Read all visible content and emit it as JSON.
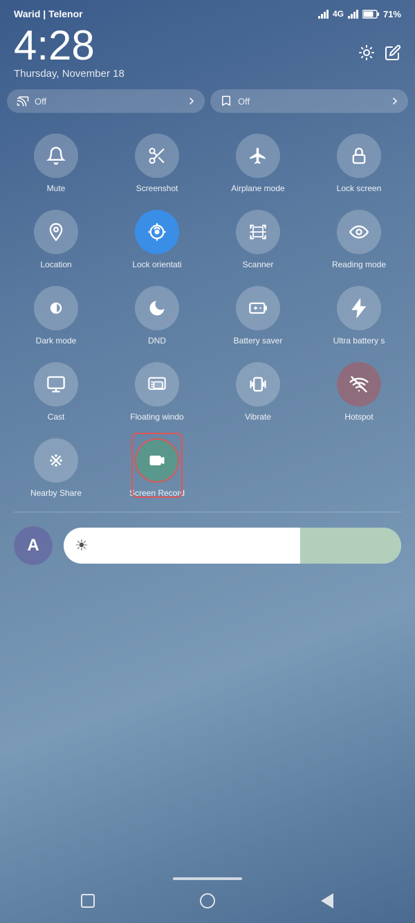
{
  "statusBar": {
    "carrier": "Warid | Telenor",
    "networkType": "4G",
    "batteryPercent": "71%"
  },
  "clock": {
    "time": "4:28",
    "date": "Thursday, November 18"
  },
  "quickToggles": [
    {
      "id": "cast-off",
      "icon": "cast",
      "label": "Off",
      "active": false
    },
    {
      "id": "bookmark-off",
      "icon": "bookmark",
      "label": "Off",
      "active": false
    }
  ],
  "quickGrid": [
    {
      "id": "mute",
      "label": "Mute",
      "icon": "bell",
      "active": false
    },
    {
      "id": "screenshot",
      "label": "Screenshot",
      "icon": "scissors",
      "active": false
    },
    {
      "id": "airplane",
      "label": "Airplane mode",
      "icon": "plane",
      "active": false
    },
    {
      "id": "lockscreen",
      "label": "Lock screen",
      "icon": "lock",
      "active": false
    },
    {
      "id": "location",
      "label": "Location",
      "icon": "location",
      "active": false
    },
    {
      "id": "lockorientation",
      "label": "Lock orientati",
      "icon": "rotate",
      "active": true
    },
    {
      "id": "scanner",
      "label": "Scanner",
      "icon": "scanner",
      "active": false
    },
    {
      "id": "readingmode",
      "label": "Reading mode",
      "icon": "eye",
      "active": false
    },
    {
      "id": "darkmode",
      "label": "Dark mode",
      "icon": "darkmode",
      "active": false
    },
    {
      "id": "dnd",
      "label": "DND",
      "icon": "moon",
      "active": false
    },
    {
      "id": "batterysaver",
      "label": "Battery saver",
      "icon": "battery",
      "active": false
    },
    {
      "id": "ultrabattery",
      "label": "Ultra battery s",
      "icon": "bolt",
      "active": false
    },
    {
      "id": "cast",
      "label": "Cast",
      "icon": "monitor",
      "active": false
    },
    {
      "id": "floatingwindow",
      "label": "Floating windo",
      "icon": "floating",
      "active": false
    },
    {
      "id": "vibrate",
      "label": "Vibrate",
      "icon": "vibrate",
      "active": false
    },
    {
      "id": "hotspot",
      "label": "Hotspot",
      "icon": "hotspot",
      "active": false,
      "reddish": true
    },
    {
      "id": "nearbyshare",
      "label": "Nearby Share",
      "icon": "nearbyshare",
      "active": false
    },
    {
      "id": "screenrecord",
      "label": "Screen Record",
      "icon": "video",
      "active": false,
      "highlighted": true
    }
  ],
  "bottomControls": {
    "avatarLabel": "A",
    "brightnessIcon": "☀"
  },
  "navBar": {
    "buttons": [
      "square",
      "circle",
      "triangle"
    ]
  }
}
